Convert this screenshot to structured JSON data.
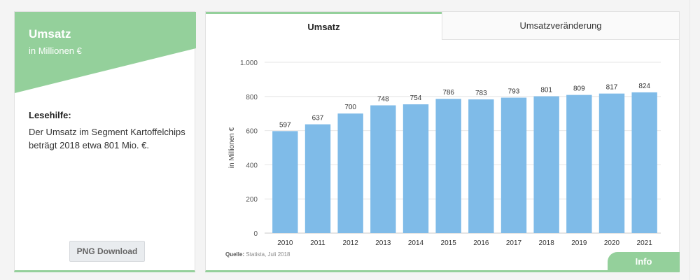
{
  "left_panel": {
    "title": "Umsatz",
    "subtitle": "in Millionen €",
    "help_title": "Lesehilfe:",
    "help_text": "Der Umsatz im Segment Kartoffelchips beträgt 2018 etwa 801 Mio. €.",
    "download_label": "PNG Download"
  },
  "tabs": {
    "active": "Umsatz",
    "inactive": "Umsatzveränderung"
  },
  "source": {
    "label": "Quelle:",
    "text": "Statista, Juli 2018"
  },
  "info_label": "Info",
  "colors": {
    "accent": "#94d09b",
    "bar": "#7fbbe8"
  },
  "chart_data": {
    "type": "bar",
    "categories": [
      "2010",
      "2011",
      "2012",
      "2013",
      "2014",
      "2015",
      "2016",
      "2017",
      "2018",
      "2019",
      "2020",
      "2021"
    ],
    "values": [
      597,
      637,
      700,
      748,
      754,
      786,
      783,
      793,
      801,
      809,
      817,
      824
    ],
    "value_labels": [
      "597",
      "637",
      "700",
      "748",
      "754",
      "786",
      "783",
      "793",
      "801",
      "809",
      "817",
      "824"
    ],
    "ylabel": "in Millionen €",
    "ylim": [
      0,
      1000
    ],
    "yticks": [
      0,
      200,
      400,
      600,
      800,
      1000
    ],
    "ytick_labels": [
      "0",
      "200",
      "400",
      "600",
      "800",
      "1.000"
    ],
    "grid": true
  }
}
